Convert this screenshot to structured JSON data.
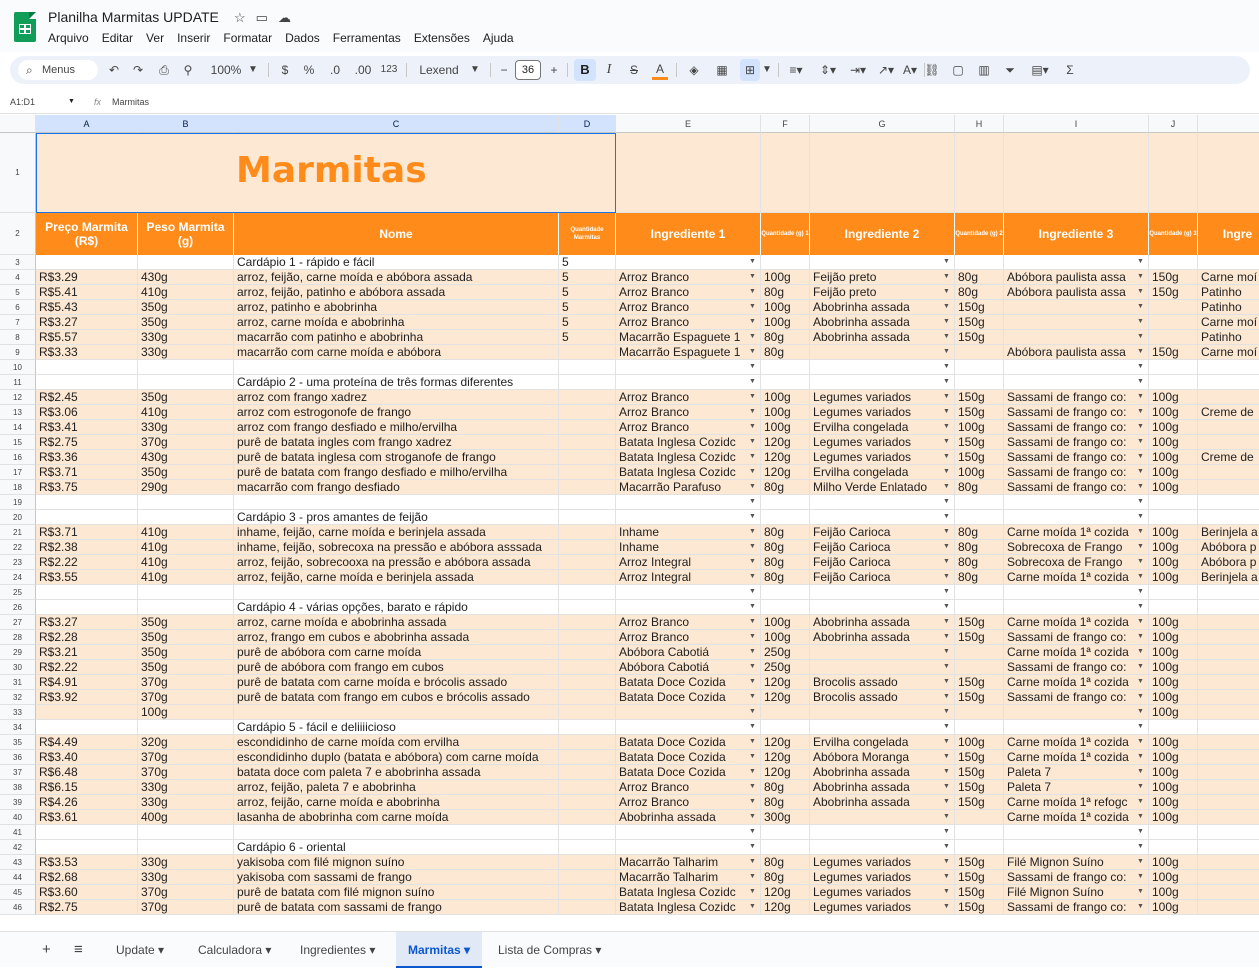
{
  "app": {
    "title": "Planilha Marmitas UPDATE",
    "menus": [
      "Arquivo",
      "Editar",
      "Ver",
      "Inserir",
      "Formatar",
      "Dados",
      "Ferramentas",
      "Extensões",
      "Ajuda"
    ]
  },
  "toolbar": {
    "search": "Menus",
    "zoom": "100%",
    "currency": "$",
    "percent": "%",
    "dec_less": ".0",
    "dec_more": ".00",
    "fmt123": "123",
    "font": "Lexend",
    "font_size": "36",
    "bold": "B",
    "italic": "I"
  },
  "formula": {
    "range": "A1:D1",
    "fx": "fx",
    "content": "Marmitas"
  },
  "columns": [
    "A",
    "B",
    "C",
    "D",
    "E",
    "F",
    "G",
    "H",
    "I",
    "J"
  ],
  "title_row": {
    "title": "Marmitas"
  },
  "headers": {
    "preco": "Preço Marmita (R$)",
    "peso": "Peso Marmita (g)",
    "nome": "Nome",
    "qtd": "Quantidade Marmitas",
    "ing1": "Ingrediente 1",
    "q1": "Quantidade (g) 1",
    "ing2": "Ingrediente 2",
    "q2": "Quantidade (g) 2",
    "ing3": "Ingrediente 3",
    "q3": "Quantidade (g) 3",
    "ing4": "Ingre"
  },
  "rows": [
    {
      "n": "3",
      "c": "Cardápio 1 - rápido e fácil",
      "d": "5",
      "dd": true
    },
    {
      "n": "4",
      "a": "R$3.29",
      "b": "430g",
      "c": "arroz, feijão, carne moída e abóbora assada",
      "d": "5",
      "e": "Arroz Branco",
      "f": "100g",
      "g": "Feijão preto",
      "h": "80g",
      "i": "Abóbora paulista assa",
      "j": "150g",
      "k": "Carne moí",
      "dd": true
    },
    {
      "n": "5",
      "a": "R$5.41",
      "b": "410g",
      "c": "arroz, feijão, patinho e abóbora assada",
      "d": "5",
      "e": "Arroz Branco",
      "f": "80g",
      "g": "Feijão preto",
      "h": "80g",
      "i": "Abóbora paulista assa",
      "j": "150g",
      "k": "Patinho",
      "dd": true
    },
    {
      "n": "6",
      "a": "R$5.43",
      "b": "350g",
      "c": "arroz, patinho e abobrinha",
      "d": "5",
      "e": "Arroz Branco",
      "f": "100g",
      "g": "Abobrinha assada",
      "h": "150g",
      "k": "Patinho",
      "dd": true
    },
    {
      "n": "7",
      "a": "R$3.27",
      "b": "350g",
      "c": "arroz, carne moída e abobrinha",
      "d": "5",
      "e": "Arroz Branco",
      "f": "100g",
      "g": "Abobrinha assada",
      "h": "150g",
      "k": "Carne moí",
      "dd": true
    },
    {
      "n": "8",
      "a": "R$5.57",
      "b": "330g",
      "c": "macarrão com patinho e abobrinha",
      "d": "5",
      "e": "Macarrão Espaguete 1",
      "f": "80g",
      "g": "Abobrinha assada",
      "h": "150g",
      "k": "Patinho",
      "dd": true
    },
    {
      "n": "9",
      "a": "R$3.33",
      "b": "330g",
      "c": "macarrão com carne moída e abóbora",
      "e": "Macarrão Espaguete 1",
      "f": "80g",
      "i": "Abóbora paulista assa",
      "j": "150g",
      "k": "Carne moí",
      "dd": true
    },
    {
      "n": "10",
      "dd": true
    },
    {
      "n": "11",
      "c": "Cardápio 2 - uma proteína de três formas diferentes",
      "dd": true
    },
    {
      "n": "12",
      "a": "R$2.45",
      "b": "350g",
      "c": "arroz com frango xadrez",
      "e": "Arroz Branco",
      "f": "100g",
      "g": "Legumes variados",
      "h": "150g",
      "i": "Sassami de frango co:",
      "j": "100g",
      "dd": true
    },
    {
      "n": "13",
      "a": "R$3.06",
      "b": "410g",
      "c": "arroz com estrogonofe de frango",
      "e": "Arroz Branco",
      "f": "100g",
      "g": "Legumes variados",
      "h": "150g",
      "i": "Sassami de frango co:",
      "j": "100g",
      "k": "Creme de",
      "dd": true
    },
    {
      "n": "14",
      "a": "R$3.41",
      "b": "330g",
      "c": "arroz com frango desfiado e milho/ervilha",
      "e": "Arroz Branco",
      "f": "100g",
      "g": "Ervilha congelada",
      "h": "100g",
      "i": "Sassami de frango co:",
      "j": "100g",
      "dd": true
    },
    {
      "n": "15",
      "a": "R$2.75",
      "b": "370g",
      "c": "purê de batata ingles com frango xadrez",
      "e": "Batata Inglesa Cozidc",
      "f": "120g",
      "g": "Legumes variados",
      "h": "150g",
      "i": "Sassami de frango co:",
      "j": "100g",
      "dd": true
    },
    {
      "n": "16",
      "a": "R$3.36",
      "b": "430g",
      "c": "purê de batata inglesa com stroganofe de frango",
      "e": "Batata Inglesa Cozidc",
      "f": "120g",
      "g": "Legumes variados",
      "h": "150g",
      "i": "Sassami de frango co:",
      "j": "100g",
      "k": "Creme de",
      "dd": true
    },
    {
      "n": "17",
      "a": "R$3.71",
      "b": "350g",
      "c": "purê de batata com frango desfiado e milho/ervilha",
      "e": "Batata Inglesa Cozidc",
      "f": "120g",
      "g": "Ervilha congelada",
      "h": "100g",
      "i": "Sassami de frango co:",
      "j": "100g",
      "dd": true
    },
    {
      "n": "18",
      "a": "R$3.75",
      "b": "290g",
      "c": "macarrão com frango desfiado",
      "e": "Macarrão Parafuso",
      "f": "80g",
      "g": "Milho Verde Enlatado",
      "h": "80g",
      "i": "Sassami de frango co:",
      "j": "100g",
      "dd": true
    },
    {
      "n": "19",
      "dd": true
    },
    {
      "n": "20",
      "c": "Cardápio 3 - pros amantes de feijão",
      "dd": true
    },
    {
      "n": "21",
      "a": "R$3.71",
      "b": "410g",
      "c": "inhame, feijão, carne moída e berinjela assada",
      "e": "Inhame",
      "f": "80g",
      "g": "Feijão Carioca",
      "h": "80g",
      "i": "Carne moída 1ª cozida",
      "j": "100g",
      "k": "Berinjela a",
      "dd": true
    },
    {
      "n": "22",
      "a": "R$2.38",
      "b": "410g",
      "c": "inhame, feijão, sobrecoxa na pressão e abóbora asssada",
      "e": "Inhame",
      "f": "80g",
      "g": "Feijão Carioca",
      "h": "80g",
      "i": "Sobrecoxa de Frango",
      "j": "100g",
      "k": "Abóbora p",
      "dd": true
    },
    {
      "n": "23",
      "a": "R$2.22",
      "b": "410g",
      "c": "arroz, feijão, sobrecooxa na pressão e abóbora assada",
      "e": "Arroz Integral",
      "f": "80g",
      "g": "Feijão Carioca",
      "h": "80g",
      "i": "Sobrecoxa de Frango",
      "j": "100g",
      "k": "Abóbora p",
      "dd": true
    },
    {
      "n": "24",
      "a": "R$3.55",
      "b": "410g",
      "c": "arroz, feijão, carne moída e berinjela assada",
      "e": "Arroz Integral",
      "f": "80g",
      "g": "Feijão Carioca",
      "h": "80g",
      "i": "Carne moída 1ª cozida",
      "j": "100g",
      "k": "Berinjela a",
      "dd": true
    },
    {
      "n": "25",
      "dd": true
    },
    {
      "n": "26",
      "c": "Cardápio 4 - várias opções, barato e rápido",
      "dd": true
    },
    {
      "n": "27",
      "a": "R$3.27",
      "b": "350g",
      "c": "arroz, carne moída e abobrinha assada",
      "e": "Arroz Branco",
      "f": "100g",
      "g": "Abobrinha assada",
      "h": "150g",
      "i": "Carne moída 1ª cozida",
      "j": "100g",
      "dd": true
    },
    {
      "n": "28",
      "a": "R$2.28",
      "b": "350g",
      "c": "arroz, frango em cubos e abobrinha assada",
      "e": "Arroz Branco",
      "f": "100g",
      "g": "Abobrinha assada",
      "h": "150g",
      "i": "Sassami de frango co:",
      "j": "100g",
      "dd": true
    },
    {
      "n": "29",
      "a": "R$3.21",
      "b": "350g",
      "c": "purê de abóbora com carne moída",
      "e": "Abóbora Cabotiá",
      "f": "250g",
      "i": "Carne moída 1ª cozida",
      "j": "100g",
      "dd": true
    },
    {
      "n": "30",
      "a": "R$2.22",
      "b": "350g",
      "c": "purê de abóbora com frango em cubos",
      "e": "Abóbora Cabotiá",
      "f": "250g",
      "i": "Sassami de frango co:",
      "j": "100g",
      "dd": true
    },
    {
      "n": "31",
      "a": "R$4.91",
      "b": "370g",
      "c": "purê de batata com carne moída e brócolis assado",
      "e": "Batata Doce Cozida",
      "f": "120g",
      "g": "Brocolis assado",
      "h": "150g",
      "i": "Carne moída 1ª cozida",
      "j": "100g",
      "dd": true
    },
    {
      "n": "32",
      "a": "R$3.92",
      "b": "370g",
      "c": "purê de batata com frango em cubos e brócolis assado",
      "e": "Batata Doce Cozida",
      "f": "120g",
      "g": "Brocolis assado",
      "h": "150g",
      "i": "Sassami de frango co:",
      "j": "100g",
      "dd": true
    },
    {
      "n": "33",
      "b": "100g",
      "j": "100g",
      "dd": true
    },
    {
      "n": "34",
      "c": "Cardápio 5 - fácil e deliiiicioso",
      "dd": true
    },
    {
      "n": "35",
      "a": "R$4.49",
      "b": "320g",
      "c": "escondidinho de carne moída com ervilha",
      "e": "Batata Doce Cozida",
      "f": "120g",
      "g": "Ervilha congelada",
      "h": "100g",
      "i": "Carne moída 1ª cozida",
      "j": "100g",
      "dd": true
    },
    {
      "n": "36",
      "a": "R$3.40",
      "b": "370g",
      "c": "escondidinho duplo (batata e abóbora) com carne moída",
      "e": "Batata Doce Cozida",
      "f": "120g",
      "g": "Abóbora Moranga",
      "h": "150g",
      "i": "Carne moída 1ª cozida",
      "j": "100g",
      "dd": true
    },
    {
      "n": "37",
      "a": "R$6.48",
      "b": "370g",
      "c": "batata doce com paleta 7 e abobrinha assada",
      "e": "Batata Doce Cozida",
      "f": "120g",
      "g": "Abobrinha assada",
      "h": "150g",
      "i": "Paleta 7",
      "j": "100g",
      "dd": true
    },
    {
      "n": "38",
      "a": "R$6.15",
      "b": "330g",
      "c": "arroz, feijão, paleta 7 e abobrinha",
      "e": "Arroz Branco",
      "f": "80g",
      "g": "Abobrinha assada",
      "h": "150g",
      "i": "Paleta 7",
      "j": "100g",
      "dd": true
    },
    {
      "n": "39",
      "a": "R$4.26",
      "b": "330g",
      "c": "arroz, feijão, carne moída e abobrinha",
      "e": "Arroz Branco",
      "f": "80g",
      "g": "Abobrinha assada",
      "h": "150g",
      "i": "Carne moída 1ª refogc",
      "j": "100g",
      "dd": true
    },
    {
      "n": "40",
      "a": "R$3.61",
      "b": "400g",
      "c": "lasanha de abobrinha com carne moída",
      "e": "Abobrinha assada",
      "f": "300g",
      "i": "Carne moída 1ª cozida",
      "j": "100g",
      "dd": true
    },
    {
      "n": "41",
      "dd": true
    },
    {
      "n": "42",
      "c": "Cardápio 6 - oriental",
      "dd": true
    },
    {
      "n": "43",
      "a": "R$3.53",
      "b": "330g",
      "c": "yakisoba com filé mignon suíno",
      "e": "Macarrão Talharim",
      "f": "80g",
      "g": "Legumes variados",
      "h": "150g",
      "i": "Filé Mignon Suíno",
      "j": "100g",
      "dd": true
    },
    {
      "n": "44",
      "a": "R$2.68",
      "b": "330g",
      "c": "yakisoba com sassami de frango",
      "e": "Macarrão Talharim",
      "f": "80g",
      "g": "Legumes variados",
      "h": "150g",
      "i": "Sassami de frango co:",
      "j": "100g",
      "dd": true
    },
    {
      "n": "45",
      "a": "R$3.60",
      "b": "370g",
      "c": "purê de batata com filé mignon suíno",
      "e": "Batata Inglesa Cozidc",
      "f": "120g",
      "g": "Legumes variados",
      "h": "150g",
      "i": "Filé Mignon Suíno",
      "j": "100g",
      "dd": true
    },
    {
      "n": "46",
      "a": "R$2.75",
      "b": "370g",
      "c": "purê de batata com sassami de frango",
      "e": "Batata Inglesa Cozidc",
      "f": "120g",
      "g": "Legumes variados",
      "h": "150g",
      "i": "Sassami de frango co:",
      "j": "100g",
      "dd": true
    }
  ],
  "sheet_tabs": [
    "Update",
    "Calculadora",
    "Ingredientes",
    "Marmitas",
    "Lista de Compras"
  ],
  "active_tab": "Marmitas",
  "colors": {
    "accent": "#ff8c1a",
    "band": "#fde8d3",
    "selected": "#d3e3fd"
  }
}
